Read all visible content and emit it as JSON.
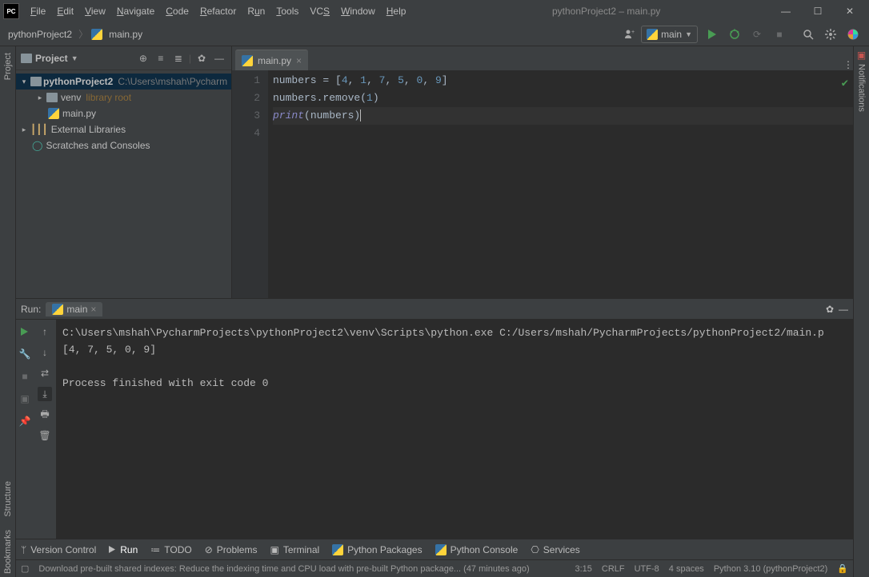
{
  "title": "pythonProject2 – main.py",
  "menu": [
    "File",
    "Edit",
    "View",
    "Navigate",
    "Code",
    "Refactor",
    "Run",
    "Tools",
    "VCS",
    "Window",
    "Help"
  ],
  "breadcrumb": {
    "proj": "pythonProject2",
    "file": "main.py"
  },
  "run_config": "main",
  "project_panel": {
    "title": "Project",
    "root_name": "pythonProject2",
    "root_path": "C:\\Users\\mshah\\Pycharm",
    "venv": "venv",
    "venv_note": "library root",
    "mainpy": "main.py",
    "ext": "External Libraries",
    "scratch": "Scratches and Consoles"
  },
  "tab": "main.py",
  "code": {
    "l1a": "numbers = [",
    "l1n": "4, 1, 7, 5, 0, 9",
    "l1b": "]",
    "l2a": "numbers.remove(",
    "l2n": "1",
    "l2b": ")",
    "l3a": "print",
    "l3b": "(numbers)"
  },
  "gutter": [
    "1",
    "2",
    "3",
    "4"
  ],
  "run": {
    "label": "Run:",
    "tab": "main",
    "cmd": "C:\\Users\\mshah\\PycharmProjects\\pythonProject2\\venv\\Scripts\\python.exe C:/Users/mshah/PycharmProjects/pythonProject2/main.p",
    "out": "[4, 7, 5, 0, 9]",
    "exit": "Process finished with exit code 0"
  },
  "bottom": {
    "vc": "Version Control",
    "run": "Run",
    "todo": "TODO",
    "problems": "Problems",
    "terminal": "Terminal",
    "pkg": "Python Packages",
    "pycon": "Python Console",
    "svc": "Services"
  },
  "status": {
    "msg": "Download pre-built shared indexes: Reduce the indexing time and CPU load with pre-built Python package... (47 minutes ago)",
    "pos": "3:15",
    "eol": "CRLF",
    "enc": "UTF-8",
    "indent": "4 spaces",
    "sdk": "Python 3.10 (pythonProject2)"
  },
  "sidebar": {
    "project": "Project",
    "structure": "Structure",
    "bookmarks": "Bookmarks",
    "notif": "Notifications"
  }
}
